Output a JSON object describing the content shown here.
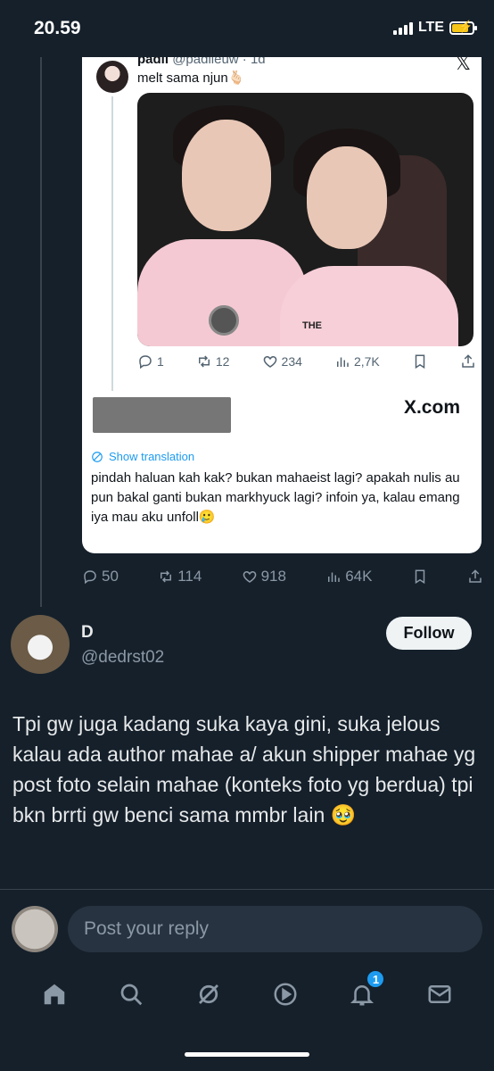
{
  "status_bar": {
    "time": "20.59",
    "network": "LTE",
    "battery_level": 0.75
  },
  "embedded_tweet": {
    "author_name": "padil",
    "author_handle": "@padlleuw · 1d",
    "text": "melt sama njun🫰🏻",
    "photo_shirt_text": "THE",
    "actions": {
      "replies": "1",
      "reposts": "12",
      "likes": "234",
      "views": "2,7K"
    },
    "site_label": "X.com",
    "show_translation": "Show translation",
    "reply_text": "pindah haluan kah kak? bukan mahaeist lagi? apakah nulis au pun bakal ganti bukan markhyuck lagi? infoin ya, kalau emang iya mau aku unfoll🥲"
  },
  "outer_actions": {
    "replies": "50",
    "reposts": "114",
    "likes": "918",
    "views": "64K"
  },
  "tweet": {
    "author_name": "D",
    "author_handle": "@dedrst02",
    "follow_label": "Follow",
    "text": "Tpi gw juga kadang suka kaya gini, suka jelous kalau ada author mahae a/ akun shipper mahae yg post foto selain mahae (konteks foto yg berdua) tpi bkn brrti gw benci sama mmbr lain 🥹"
  },
  "reply": {
    "placeholder": "Post your reply"
  },
  "bottom_nav": {
    "items": [
      "home-icon",
      "search-icon",
      "grok-icon",
      "video-icon",
      "notifications-icon",
      "messages-icon"
    ],
    "notification_badge": "1"
  },
  "colors": {
    "background": "#15202b",
    "accent": "#1d9bf0",
    "text": "#e7e9ea",
    "muted": "#8b98a5"
  }
}
